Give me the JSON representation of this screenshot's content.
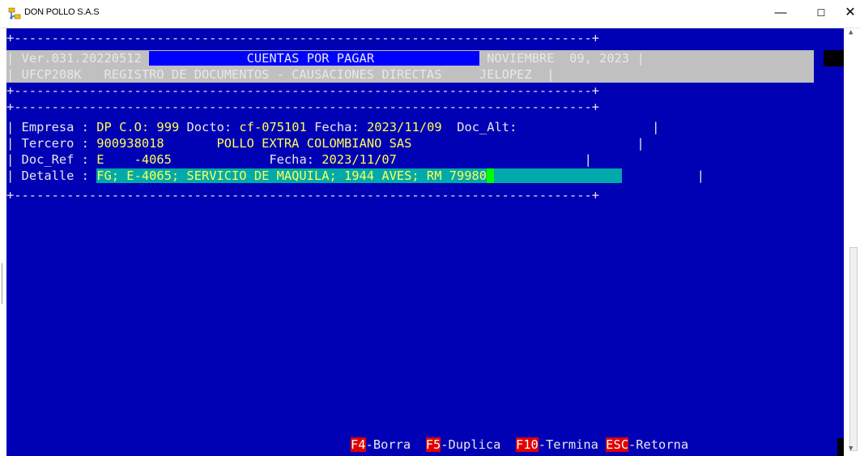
{
  "window": {
    "title": "DON POLLO S.A.S",
    "minimize_glyph": "—",
    "maximize_glyph": "☐",
    "close_glyph": "✕",
    "icon": "app-network-icon"
  },
  "terminal": {
    "border_top": "+-----------------------------------------------------------------------------+",
    "border_mid": "+-----------------------------------------------------------------------------+",
    "border_bottom": "+-----------------------------------------------------------------------------+",
    "version": "Ver.031.20220512",
    "module_title": "CUENTAS POR PAGAR",
    "date_month": "NOVIEMBRE",
    "date_day_year": "09, 2023",
    "program_code": "UFCP208K",
    "screen_title": "REGISTRO DE DOCUMENTOS - CAUSACIONES DIRECTAS",
    "user": "JELOPEZ",
    "fields": {
      "empresa_label": "Empresa :",
      "empresa_value": "DP",
      "co_label": "C.O:",
      "co_value": "999",
      "docto_label": "Docto:",
      "docto_value": "cf-075101",
      "fecha_label": "Fecha:",
      "fecha_value": "2023/11/09",
      "docalt_label": "Doc_Alt:",
      "tercero_label": "Tercero :",
      "tercero_value": "900938018",
      "tercero_name": "POLLO EXTRA COLOMBIANO SAS",
      "docref_label": "Doc_Ref :",
      "docref_value": "E    -4065",
      "fecha2_label": "Fecha:",
      "fecha2_value": "2023/11/07",
      "detalle_label": "Detalle :",
      "detalle_value": "FG; E-4065; SERVICIO DE MAQUILA; 1944 AVES; RM 79980"
    },
    "function_keys": [
      {
        "key": "F4",
        "label": "-Borra"
      },
      {
        "key": "F5",
        "label": "-Duplica"
      },
      {
        "key": "F10",
        "label": "-Termina"
      },
      {
        "key": "ESC",
        "label": "-Retorna"
      }
    ]
  },
  "colors": {
    "terminal_bg": "#0000b4",
    "highlight_bg": "#0000ff",
    "header_gray": "#c0c0c0",
    "value_yellow": "#ffff55",
    "field_teal": "#00aaaa",
    "cursor_green": "#00ff00",
    "fkey_red": "#e00000"
  }
}
